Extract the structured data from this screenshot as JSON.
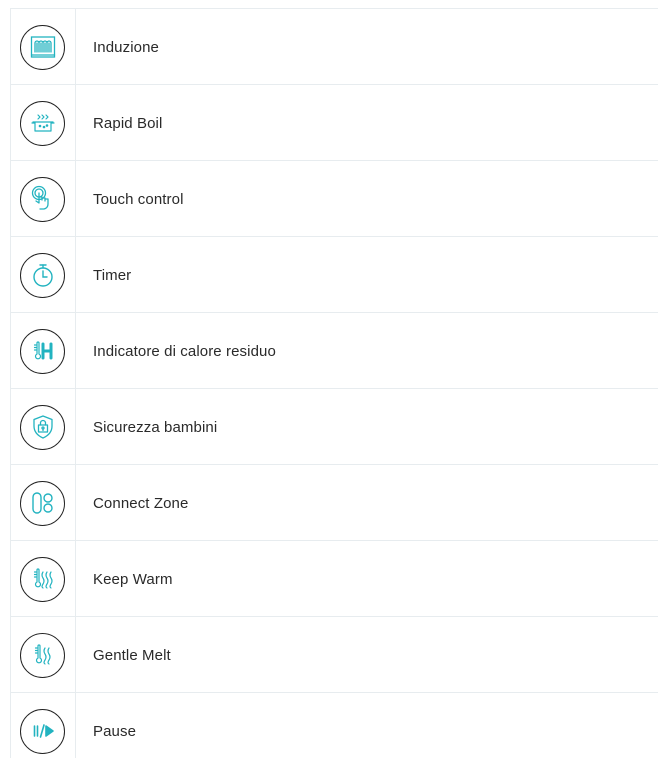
{
  "accent_color": "#22b3c0",
  "features": [
    {
      "label": "Induzione",
      "icon": "induction-coil-icon"
    },
    {
      "label": "Rapid Boil",
      "icon": "rapid-boil-pot-icon"
    },
    {
      "label": "Touch control",
      "icon": "touch-finger-icon"
    },
    {
      "label": "Timer",
      "icon": "timer-stopwatch-icon"
    },
    {
      "label": "Indicatore di calore residuo",
      "icon": "residual-heat-h-icon"
    },
    {
      "label": "Sicurezza bambini",
      "icon": "child-lock-shield-icon"
    },
    {
      "label": "Connect Zone",
      "icon": "connect-zone-icon"
    },
    {
      "label": "Keep Warm",
      "icon": "keep-warm-thermometer-icon"
    },
    {
      "label": "Gentle Melt",
      "icon": "gentle-melt-thermometer-icon"
    },
    {
      "label": "Pause",
      "icon": "pause-play-icon"
    }
  ]
}
